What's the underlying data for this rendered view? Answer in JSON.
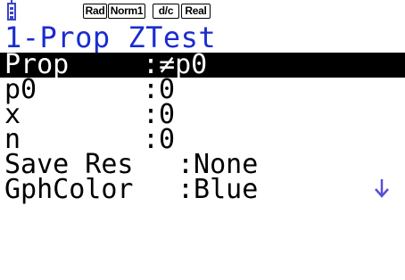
{
  "status_bar": {
    "battery_icon": "battery-icon",
    "badges": [
      "Rad",
      "Norm1",
      "d/c",
      "Real"
    ]
  },
  "title": "1-Prop ZTest",
  "rows": [
    {
      "key": "Prop",
      "value": ":≠p0",
      "selected": true
    },
    {
      "key": "p0",
      "value": ":0",
      "selected": false
    },
    {
      "key": "x",
      "value": ":0",
      "selected": false
    },
    {
      "key": "n",
      "value": ":0",
      "selected": false
    },
    {
      "key": "Save Res",
      "value": ":None",
      "selected": false
    },
    {
      "key": "GphColor",
      "value": ":Blue",
      "selected": false
    }
  ],
  "scroll_indicator": "down-arrow-icon",
  "colors": {
    "title": "#1a2cd0",
    "highlight": "#000000",
    "arrow": "#5a4fd8"
  }
}
